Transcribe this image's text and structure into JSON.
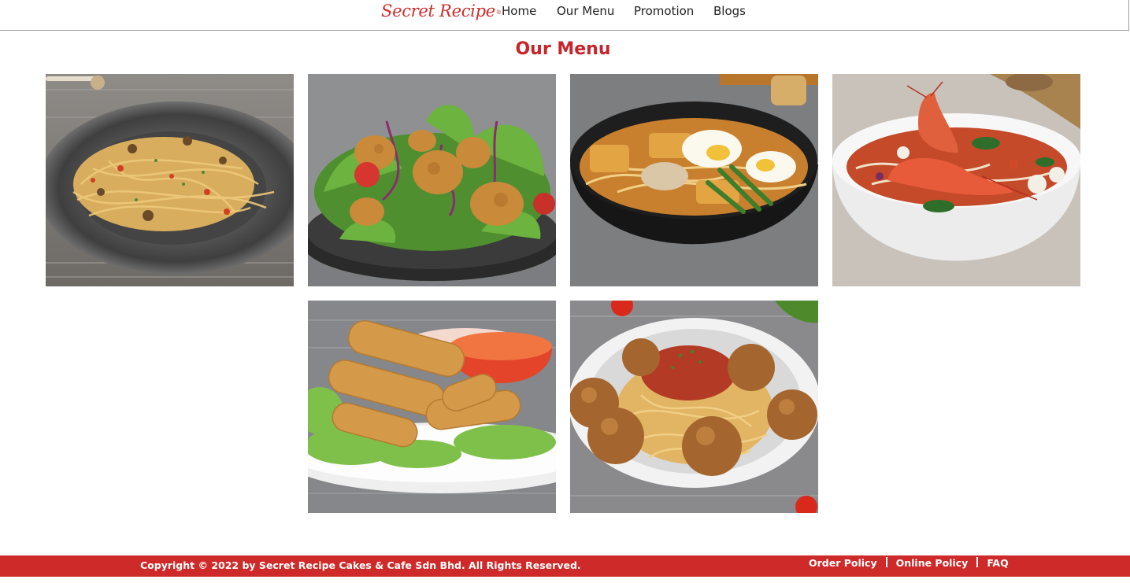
{
  "header": {
    "logo_text": "Secret Recipe",
    "logo_mark": "®",
    "nav": [
      {
        "label": "Home"
      },
      {
        "label": "Our Menu"
      },
      {
        "label": "Promotion"
      },
      {
        "label": "Blogs"
      }
    ]
  },
  "main": {
    "title": "Our Menu",
    "items": [
      {
        "image": "aglio-olio-pasta-photo"
      },
      {
        "image": "crispy-chicken-salad-photo"
      },
      {
        "image": "curry-laksa-photo"
      },
      {
        "image": "tom-yam-prawn-noodle-photo"
      },
      {
        "image": "spring-rolls-photo"
      },
      {
        "image": "spaghetti-meatballs-photo"
      }
    ]
  },
  "footer": {
    "copyright": "Copyright © 2022 by Secret Recipe Cakes & Cafe Sdn Bhd. All Rights Reserved.",
    "links": [
      {
        "label": "Order Policy"
      },
      {
        "label": "Online Policy"
      },
      {
        "label": "FAQ"
      }
    ]
  },
  "colors": {
    "brand_red": "#c8242a",
    "footer_red": "#cf2a2a"
  }
}
